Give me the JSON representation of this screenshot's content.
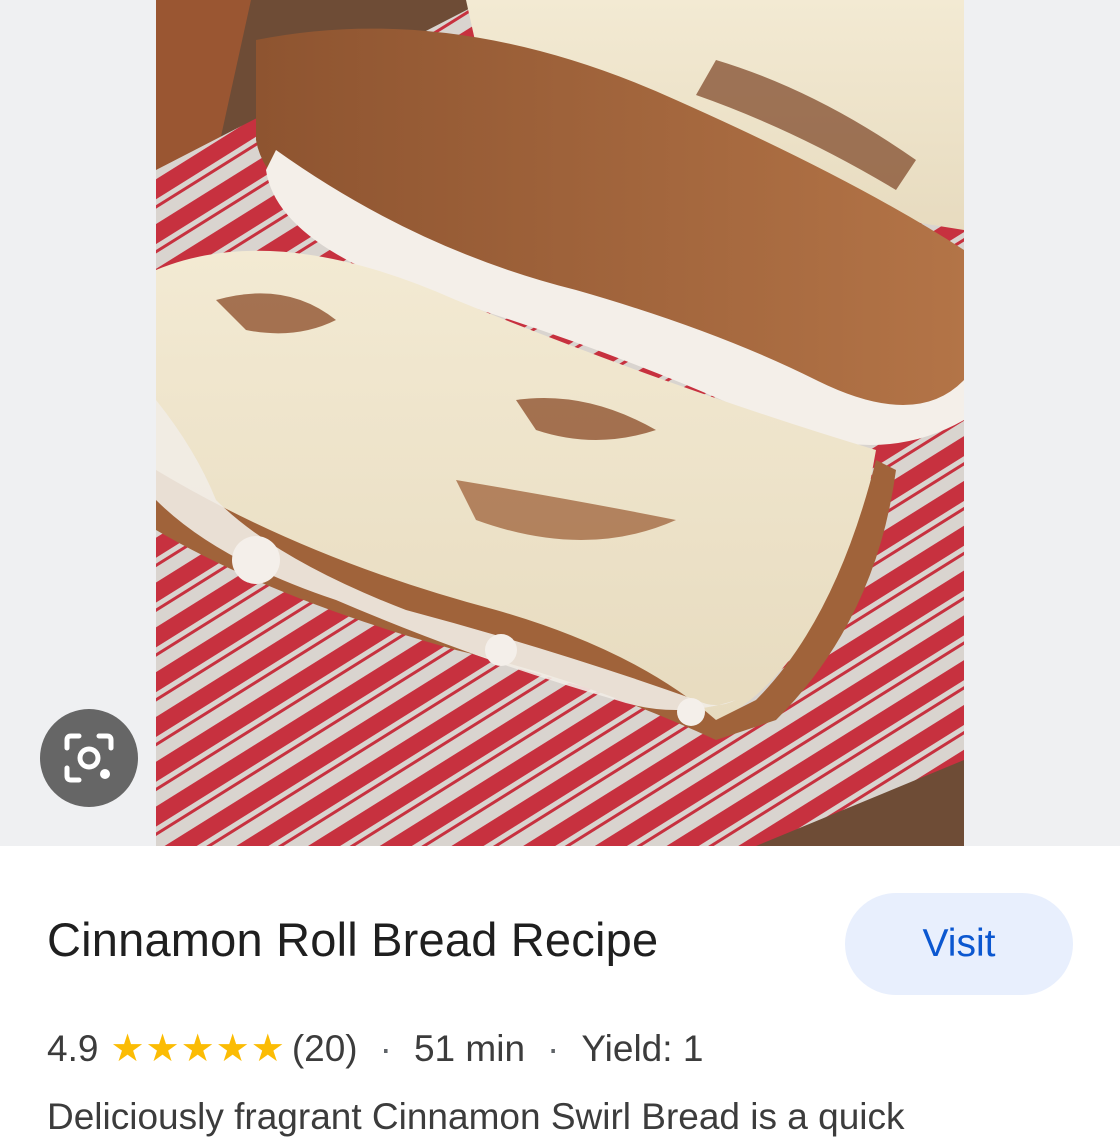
{
  "result": {
    "title": "Cinnamon Roll Bread Recipe",
    "visit_label": "Visit",
    "rating": "4.9",
    "stars": 5,
    "review_count": "(20)",
    "separator": "·",
    "time": "51 min",
    "yield": "Yield: 1",
    "description": "Deliciously fragrant Cinnamon Swirl Bread is a quick"
  },
  "icons": {
    "lens": "google-lens-icon",
    "star": "star-icon"
  },
  "colors": {
    "visit_bg": "#e8effd",
    "visit_text": "#0b57d0",
    "star": "#fbbc04",
    "image_bg": "#eff0f2"
  }
}
